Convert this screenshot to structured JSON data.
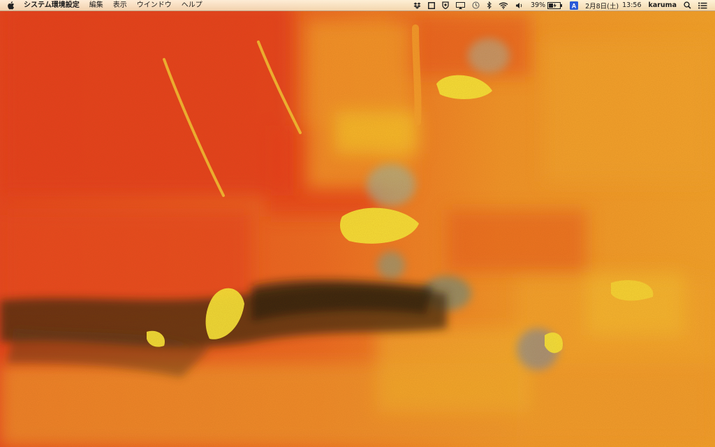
{
  "menubar": {
    "apple_icon": "apple-logo-icon",
    "app_name": "システム環境設定",
    "menus": [
      "編集",
      "表示",
      "ウインドウ",
      "ヘルプ"
    ],
    "battery_percent": "39%",
    "input_source": "A",
    "date": "2月8日(土)",
    "time": "13:56",
    "user": "karuma",
    "icons": [
      "dropbox-icon",
      "window-icon",
      "security-shield-icon",
      "airplay-display-icon",
      "time-machine-icon",
      "bluetooth-icon",
      "wifi-icon",
      "volume-icon",
      "battery-charging-icon",
      "input-source-icon",
      "spotlight-search-icon",
      "notification-center-icon"
    ]
  },
  "wallpaper": {
    "description_colors": [
      "#e8431f",
      "#f08a22",
      "#f7c22a",
      "#f6e23a",
      "#2a2a20"
    ]
  }
}
